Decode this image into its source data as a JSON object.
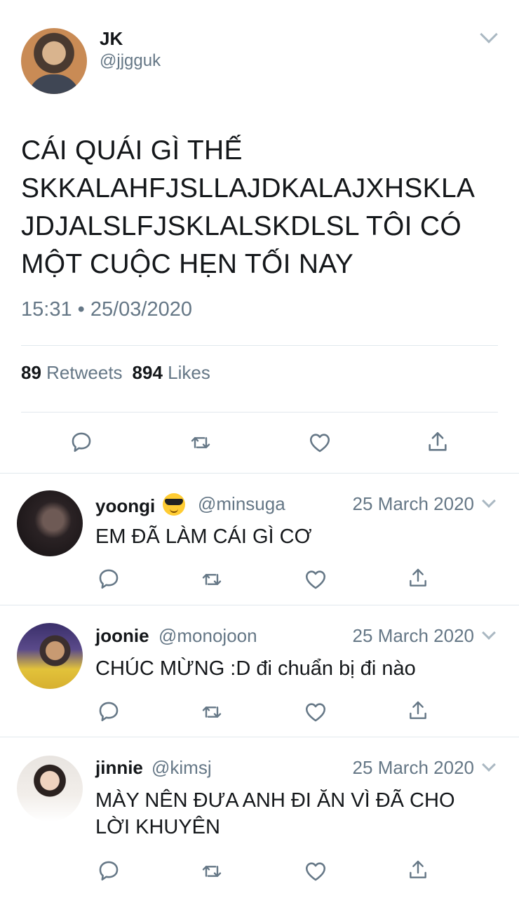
{
  "main_tweet": {
    "author_name": "JK",
    "author_handle": "@jjgguk",
    "text_lines": [
      "CÁI QUÁI GÌ THẾ",
      "SKKALAHFJSLLAJDKALAJXHSKLA",
      "JDJALSLFJSKLALSKDLSL TÔI CÓ",
      "MỘT CUỘC HẸN TỐI NAY"
    ],
    "timestamp": "15:31 • 25/03/2020",
    "retweet_count": "89",
    "retweet_label": "Retweets",
    "like_count": "894",
    "like_label": "Likes"
  },
  "replies": [
    {
      "name": "yoongi",
      "emoji": "smiling-face-with-sunglasses",
      "handle": "@minsuga",
      "date": "25 March 2020",
      "text_lines": [
        "EM ĐÃ LÀM CÁI GÌ CƠ"
      ]
    },
    {
      "name": "joonie",
      "handle": "@monojoon",
      "date": "25 March 2020",
      "text_lines": [
        "CHÚC MỪNG :D đi chuẩn bị đi nào"
      ]
    },
    {
      "name": "jinnie",
      "handle": "@kimsj",
      "date": "25 March 2020",
      "text_lines": [
        "MÀY NÊN ĐƯA ANH ĐI ĂN VÌ ĐÃ CHO",
        "LỜI KHUYÊN"
      ]
    }
  ],
  "action_icons": [
    "reply-icon",
    "retweet-icon",
    "like-icon",
    "share-icon"
  ],
  "colors": {
    "text_primary": "#14171a",
    "text_secondary": "#657786",
    "divider": "#e1e8ed",
    "caret": "#aab8c2"
  }
}
